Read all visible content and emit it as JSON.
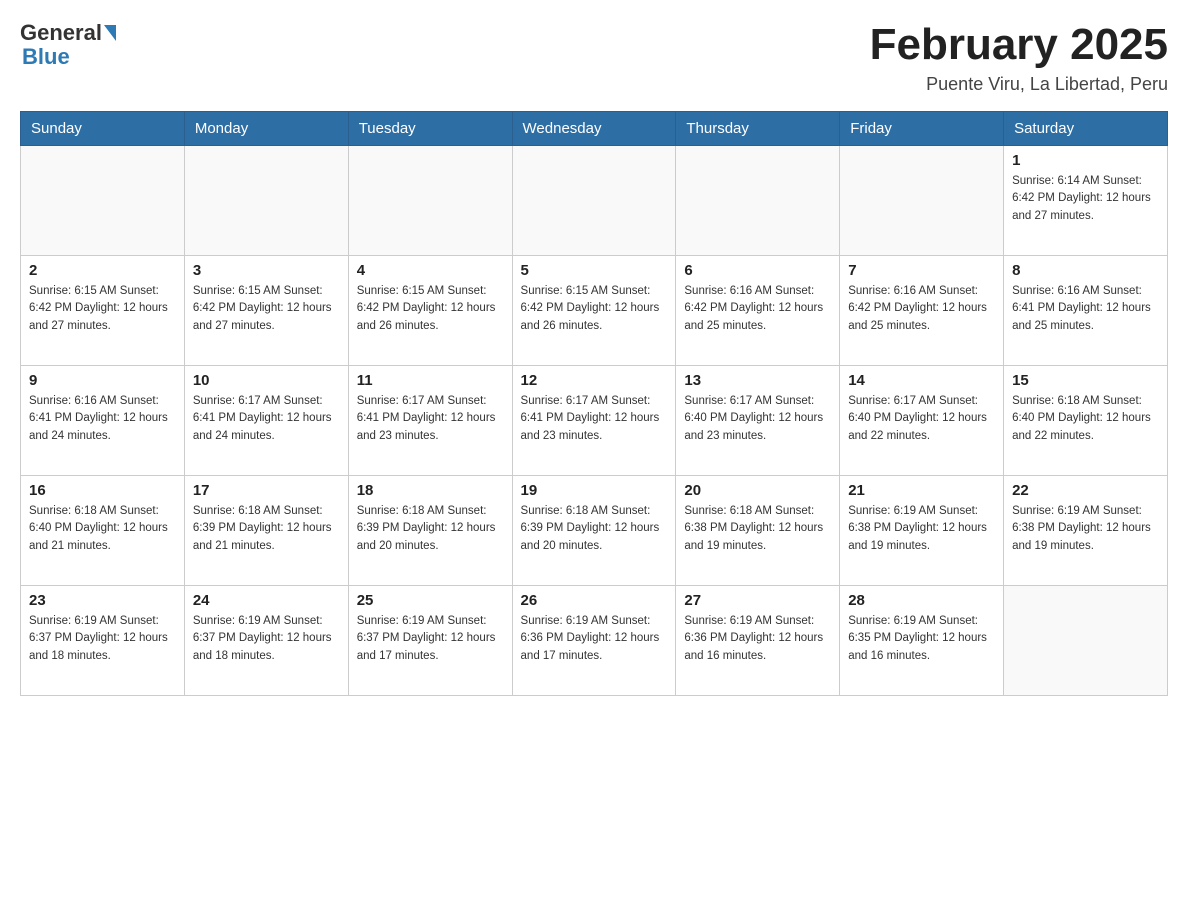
{
  "header": {
    "logo_general": "General",
    "logo_blue": "Blue",
    "title": "February 2025",
    "location": "Puente Viru, La Libertad, Peru"
  },
  "days_of_week": [
    "Sunday",
    "Monday",
    "Tuesday",
    "Wednesday",
    "Thursday",
    "Friday",
    "Saturday"
  ],
  "weeks": [
    [
      {
        "day": "",
        "info": ""
      },
      {
        "day": "",
        "info": ""
      },
      {
        "day": "",
        "info": ""
      },
      {
        "day": "",
        "info": ""
      },
      {
        "day": "",
        "info": ""
      },
      {
        "day": "",
        "info": ""
      },
      {
        "day": "1",
        "info": "Sunrise: 6:14 AM\nSunset: 6:42 PM\nDaylight: 12 hours and 27 minutes."
      }
    ],
    [
      {
        "day": "2",
        "info": "Sunrise: 6:15 AM\nSunset: 6:42 PM\nDaylight: 12 hours and 27 minutes."
      },
      {
        "day": "3",
        "info": "Sunrise: 6:15 AM\nSunset: 6:42 PM\nDaylight: 12 hours and 27 minutes."
      },
      {
        "day": "4",
        "info": "Sunrise: 6:15 AM\nSunset: 6:42 PM\nDaylight: 12 hours and 26 minutes."
      },
      {
        "day": "5",
        "info": "Sunrise: 6:15 AM\nSunset: 6:42 PM\nDaylight: 12 hours and 26 minutes."
      },
      {
        "day": "6",
        "info": "Sunrise: 6:16 AM\nSunset: 6:42 PM\nDaylight: 12 hours and 25 minutes."
      },
      {
        "day": "7",
        "info": "Sunrise: 6:16 AM\nSunset: 6:42 PM\nDaylight: 12 hours and 25 minutes."
      },
      {
        "day": "8",
        "info": "Sunrise: 6:16 AM\nSunset: 6:41 PM\nDaylight: 12 hours and 25 minutes."
      }
    ],
    [
      {
        "day": "9",
        "info": "Sunrise: 6:16 AM\nSunset: 6:41 PM\nDaylight: 12 hours and 24 minutes."
      },
      {
        "day": "10",
        "info": "Sunrise: 6:17 AM\nSunset: 6:41 PM\nDaylight: 12 hours and 24 minutes."
      },
      {
        "day": "11",
        "info": "Sunrise: 6:17 AM\nSunset: 6:41 PM\nDaylight: 12 hours and 23 minutes."
      },
      {
        "day": "12",
        "info": "Sunrise: 6:17 AM\nSunset: 6:41 PM\nDaylight: 12 hours and 23 minutes."
      },
      {
        "day": "13",
        "info": "Sunrise: 6:17 AM\nSunset: 6:40 PM\nDaylight: 12 hours and 23 minutes."
      },
      {
        "day": "14",
        "info": "Sunrise: 6:17 AM\nSunset: 6:40 PM\nDaylight: 12 hours and 22 minutes."
      },
      {
        "day": "15",
        "info": "Sunrise: 6:18 AM\nSunset: 6:40 PM\nDaylight: 12 hours and 22 minutes."
      }
    ],
    [
      {
        "day": "16",
        "info": "Sunrise: 6:18 AM\nSunset: 6:40 PM\nDaylight: 12 hours and 21 minutes."
      },
      {
        "day": "17",
        "info": "Sunrise: 6:18 AM\nSunset: 6:39 PM\nDaylight: 12 hours and 21 minutes."
      },
      {
        "day": "18",
        "info": "Sunrise: 6:18 AM\nSunset: 6:39 PM\nDaylight: 12 hours and 20 minutes."
      },
      {
        "day": "19",
        "info": "Sunrise: 6:18 AM\nSunset: 6:39 PM\nDaylight: 12 hours and 20 minutes."
      },
      {
        "day": "20",
        "info": "Sunrise: 6:18 AM\nSunset: 6:38 PM\nDaylight: 12 hours and 19 minutes."
      },
      {
        "day": "21",
        "info": "Sunrise: 6:19 AM\nSunset: 6:38 PM\nDaylight: 12 hours and 19 minutes."
      },
      {
        "day": "22",
        "info": "Sunrise: 6:19 AM\nSunset: 6:38 PM\nDaylight: 12 hours and 19 minutes."
      }
    ],
    [
      {
        "day": "23",
        "info": "Sunrise: 6:19 AM\nSunset: 6:37 PM\nDaylight: 12 hours and 18 minutes."
      },
      {
        "day": "24",
        "info": "Sunrise: 6:19 AM\nSunset: 6:37 PM\nDaylight: 12 hours and 18 minutes."
      },
      {
        "day": "25",
        "info": "Sunrise: 6:19 AM\nSunset: 6:37 PM\nDaylight: 12 hours and 17 minutes."
      },
      {
        "day": "26",
        "info": "Sunrise: 6:19 AM\nSunset: 6:36 PM\nDaylight: 12 hours and 17 minutes."
      },
      {
        "day": "27",
        "info": "Sunrise: 6:19 AM\nSunset: 6:36 PM\nDaylight: 12 hours and 16 minutes."
      },
      {
        "day": "28",
        "info": "Sunrise: 6:19 AM\nSunset: 6:35 PM\nDaylight: 12 hours and 16 minutes."
      },
      {
        "day": "",
        "info": ""
      }
    ]
  ]
}
